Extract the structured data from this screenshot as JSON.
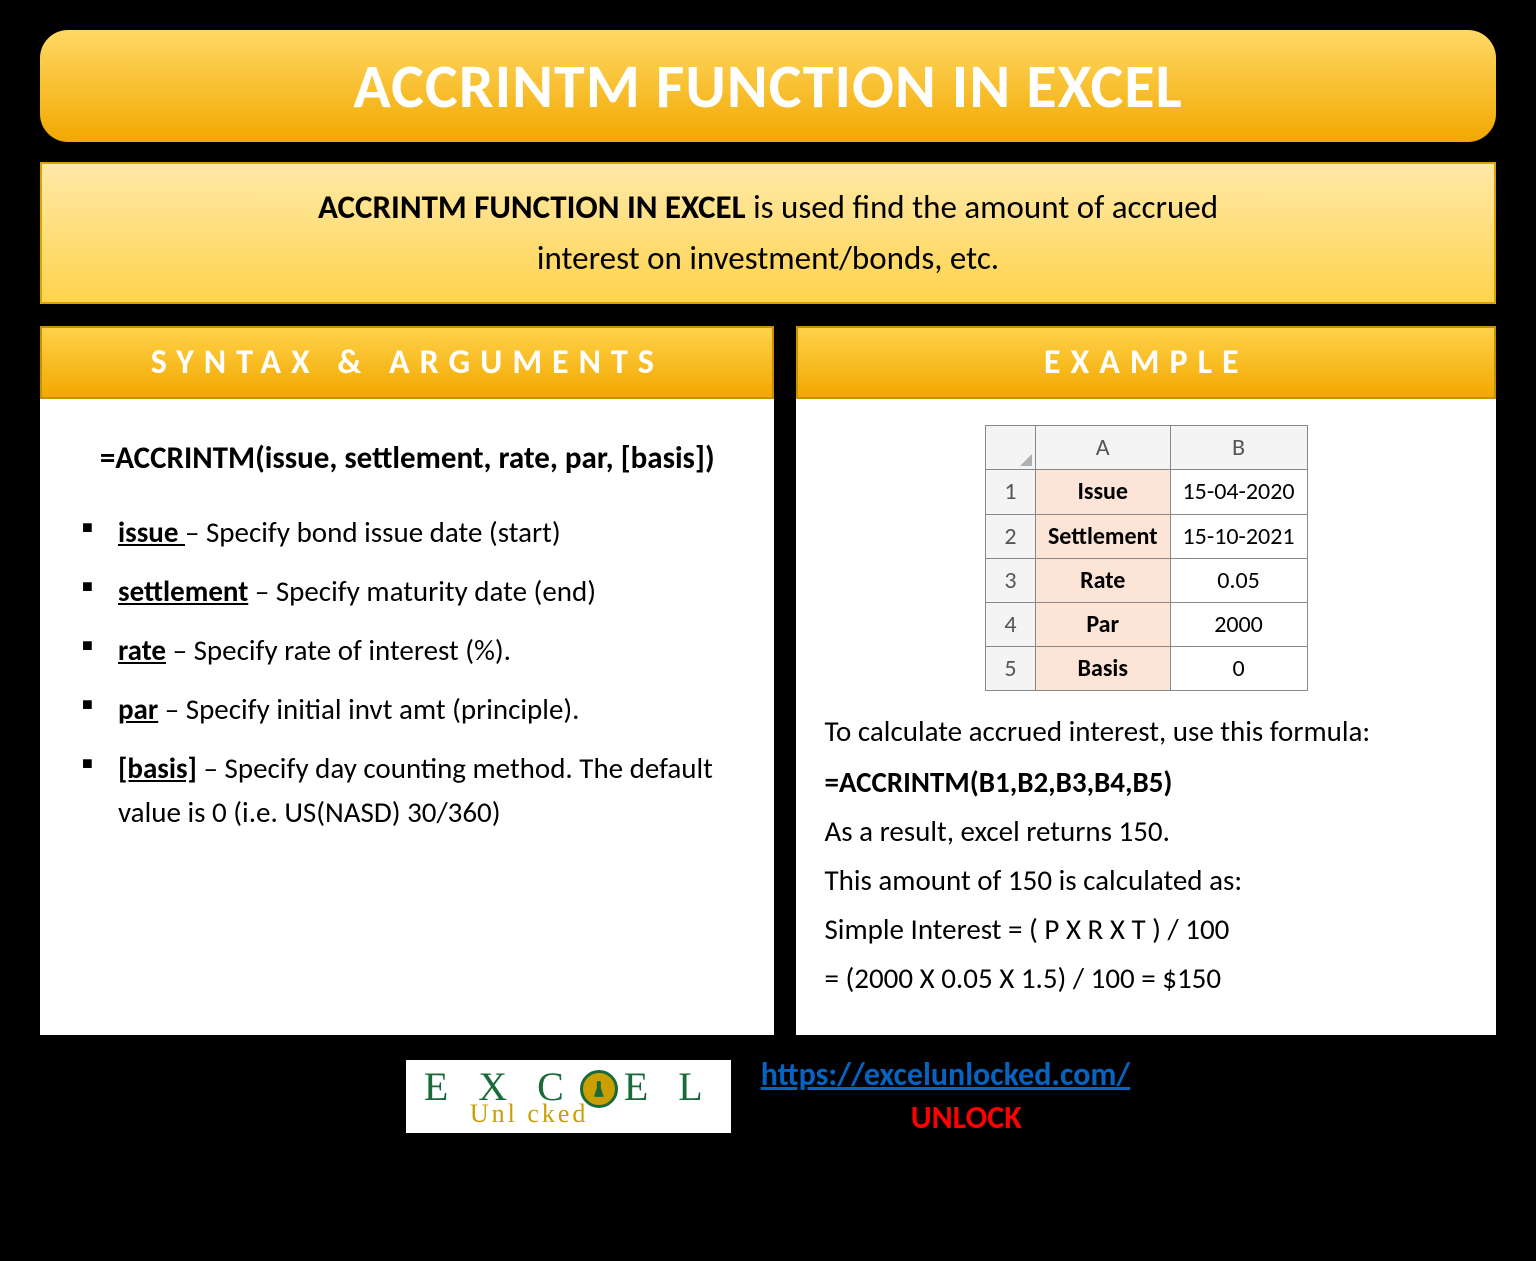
{
  "title": "ACCRINTM FUNCTION IN EXCEL",
  "description": {
    "lead": "ACCRINTM FUNCTION IN EXCEL",
    "rest1": " is used find the amount of accrued",
    "rest2": "interest on investment/bonds, etc."
  },
  "syntax": {
    "heading": "SYNTAX & ARGUMENTS",
    "formula": "=ACCRINTM(issue, settlement, rate, par, [basis])",
    "args": [
      {
        "name": "issue ",
        "desc": " – Specify bond issue date (start)"
      },
      {
        "name": "settlement",
        "desc": " – Specify maturity date (end)"
      },
      {
        "name": "rate",
        "desc": " – Specify rate of interest (%)."
      },
      {
        "name": "par",
        "desc": " – Specify initial invt amt (principle)."
      },
      {
        "name": "[basis]",
        "desc": " – Specify day counting method. The default value is 0 (i.e. US(NASD) 30/360)"
      }
    ]
  },
  "example": {
    "heading": "EXAMPLE",
    "sheet": {
      "cols": [
        "A",
        "B"
      ],
      "rows": [
        {
          "n": "1",
          "a": "Issue",
          "b": "15-04-2020"
        },
        {
          "n": "2",
          "a": "Settlement",
          "b": "15-10-2021"
        },
        {
          "n": "3",
          "a": "Rate",
          "b": "0.05"
        },
        {
          "n": "4",
          "a": "Par",
          "b": "2000"
        },
        {
          "n": "5",
          "a": "Basis",
          "b": "0"
        }
      ]
    },
    "text": {
      "intro": "To calculate accrued interest, use this formula:",
      "formula": "=ACCRINTM(B1,B2,B3,B4,B5)",
      "result": "As a result, excel returns 150.",
      "calc1": "This amount of 150 is calculated as:",
      "calc2": "Simple Interest = ( P X R X T ) / 100",
      "calc3": "= (2000 X 0.05 X 1.5) / 100 = $150"
    }
  },
  "footer": {
    "logo_top1": "E X C",
    "logo_top2": "E L",
    "logo_bottom": "Unl   cked",
    "link": "https://excelunlocked.com/",
    "unlock": "UNLOCK"
  }
}
